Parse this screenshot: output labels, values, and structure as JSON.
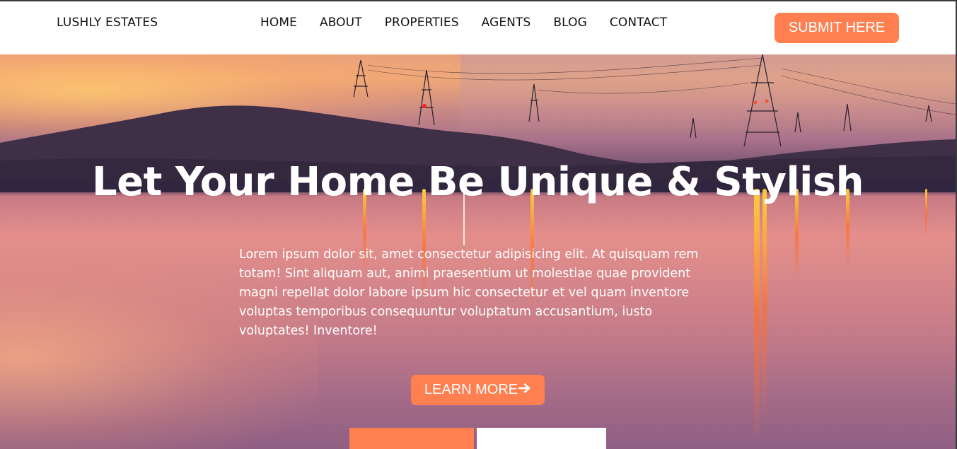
{
  "navbar": {
    "brand": "LUSHLY ESTATES",
    "links": [
      "HOME",
      "ABOUT",
      "PROPERTIES",
      "AGENTS",
      "BLOG",
      "CONTACT"
    ],
    "submit_label": "SUBMIT HERE"
  },
  "hero": {
    "title": "Let Your Home Be Unique & Stylish",
    "text": "Lorem ipsum dolor sit, amet consectetur adipisicing elit. At quisquam rem totam! Sint aliquam aut, animi praesentium ut molestiae quae provident magni repellat dolor labore ipsum hic consectetur et vel quam inventore voluptas temporibus consequuntur voluptatum accusantium, iusto voluptates! Inventore!",
    "learn_more_label": "LEARN MORE",
    "learn_more_icon": "arrow-right-icon"
  },
  "colors": {
    "accent": "#ff7f50",
    "nav_bg": "#ffffff",
    "text_dark": "#111111",
    "text_light": "#ffffff"
  }
}
